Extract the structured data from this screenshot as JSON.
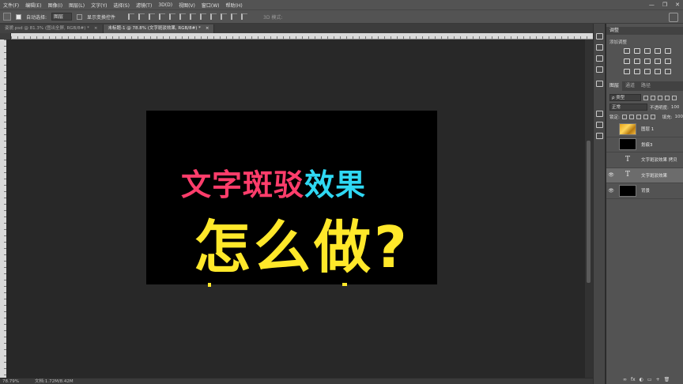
{
  "menubar": {
    "items": [
      "文件(F)",
      "编辑(E)",
      "图像(I)",
      "图层(L)",
      "文字(Y)",
      "选择(S)",
      "滤镜(T)",
      "3D(D)",
      "视图(V)",
      "窗口(W)",
      "帮助(H)"
    ],
    "min": "—",
    "max": "❐",
    "close": "✕"
  },
  "optbar": {
    "auto_select": "自动选择:",
    "auto_select_target": "图层",
    "show_transform": "显示变换控件",
    "mode3d": "3D 模式:"
  },
  "tabs": [
    {
      "label": "姿貌.psd @ 81.3% (图出全屏, RGB/8#) *",
      "close": "×"
    },
    {
      "label": "未标题-1 @ 78.8% (文字斑驳效果, RGB/8#) *",
      "close": "×"
    }
  ],
  "canvas": {
    "line1_pink": "文字斑驳",
    "line1_cyan": "效果",
    "line2": "怎么做?",
    "colors": {
      "pink": "#ff3d6b",
      "cyan": "#2fd8f3",
      "yellow": "#ffe82a",
      "bg": "#000000"
    }
  },
  "status": {
    "zoom": "78.79%",
    "doc": "文档:1.72M/8.42M"
  },
  "adjustments": {
    "title": "调整",
    "subtitle": "添加调整"
  },
  "layers_panel": {
    "tabs": [
      "图层",
      "通道",
      "路径"
    ],
    "filter_type": "ρ 类型",
    "blend_mode": "正常",
    "opacity_label": "不透明度:",
    "opacity_value": "100",
    "lock_label": "锁定:",
    "fill_label": "填充:",
    "fill_value": "100",
    "layers": [
      {
        "name": "图层 1",
        "visible": false,
        "kind": "gold"
      },
      {
        "name": "划痕3",
        "visible": false,
        "kind": "mask"
      },
      {
        "name": "文字斑驳效果 拷贝",
        "visible": false,
        "kind": "text",
        "glyph": "T"
      },
      {
        "name": "文字斑驳效果",
        "visible": true,
        "kind": "text",
        "glyph": "T",
        "selected": true
      },
      {
        "name": "背景",
        "visible": true,
        "kind": "black"
      }
    ],
    "bottom_icons": [
      "∞",
      "fx",
      "◐",
      "▭",
      "+",
      "🗑"
    ]
  }
}
